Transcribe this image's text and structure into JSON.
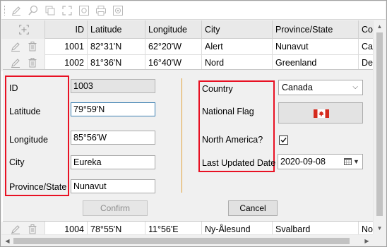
{
  "toolbar": {
    "buttons": [
      "edit-icon",
      "search-icon",
      "copy-icon",
      "fit-icon",
      "snapshot-icon",
      "print-icon",
      "export-icon"
    ]
  },
  "grid": {
    "columns": {
      "id": "ID",
      "latitude": "Latitude",
      "longitude": "Longitude",
      "city": "City",
      "province": "Province/State",
      "country_partial": "Co"
    },
    "rows": [
      {
        "id": "1001",
        "latitude": "82°31'N",
        "longitude": "62°20'W",
        "city": "Alert",
        "province": "Nunavut",
        "country_partial": "Ca"
      },
      {
        "id": "1002",
        "latitude": "81°36'N",
        "longitude": "16°40'W",
        "city": "Nord",
        "province": "Greenland",
        "country_partial": "De"
      },
      {
        "id": "1004",
        "latitude": "78°55'N",
        "longitude": "11°56'E",
        "city": "Ny-Ålesund",
        "province": "Svalbard",
        "country_partial": "No"
      }
    ]
  },
  "form": {
    "labels": {
      "id": "ID",
      "latitude": "Latitude",
      "longitude": "Longitude",
      "city": "City",
      "province": "Province/State",
      "country": "Country",
      "flag": "National Flag",
      "north_america": "North America?",
      "last_updated": "Last Updated Date"
    },
    "values": {
      "id": "1003",
      "latitude": "79°59'N",
      "longitude": "85°56'W",
      "city": "Eureka",
      "province": "Nunavut",
      "country": "Canada",
      "north_america": true,
      "last_updated": "2020-09-08"
    },
    "buttons": {
      "confirm": "Confirm",
      "cancel": "Cancel"
    },
    "colors": {
      "highlight": "#e81123",
      "separator": "#e3a33c",
      "flag_red": "#d52b1e"
    }
  }
}
